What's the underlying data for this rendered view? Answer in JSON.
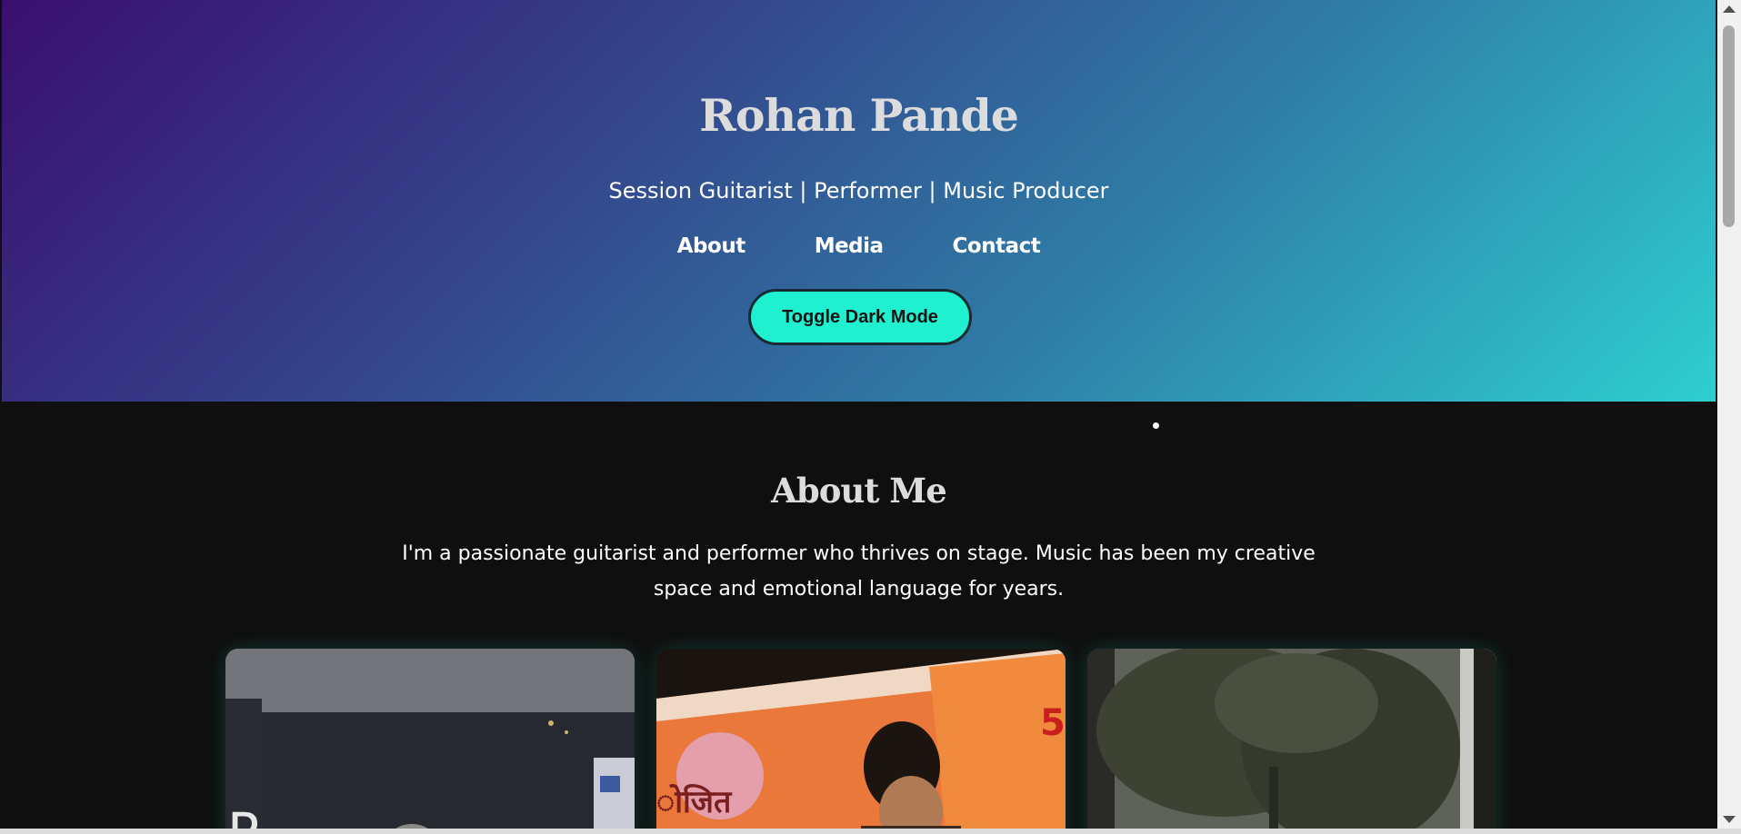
{
  "hero": {
    "title": "Rohan Pande",
    "subtitle": "Session Guitarist | Performer | Music Producer",
    "nav": [
      {
        "label": "About"
      },
      {
        "label": "Media"
      },
      {
        "label": "Contact"
      }
    ],
    "toggle_label": "Toggle Dark Mode"
  },
  "about": {
    "title": "About Me",
    "text": "I'm a passionate guitarist and performer who thrives on stage. Music has been my creative space and emotional language for years."
  },
  "colors": {
    "accent": "#1ff0cf",
    "gradient_start": "#3a0f6f",
    "gradient_end": "#2ecfd0",
    "background": "#0f0f0f"
  }
}
